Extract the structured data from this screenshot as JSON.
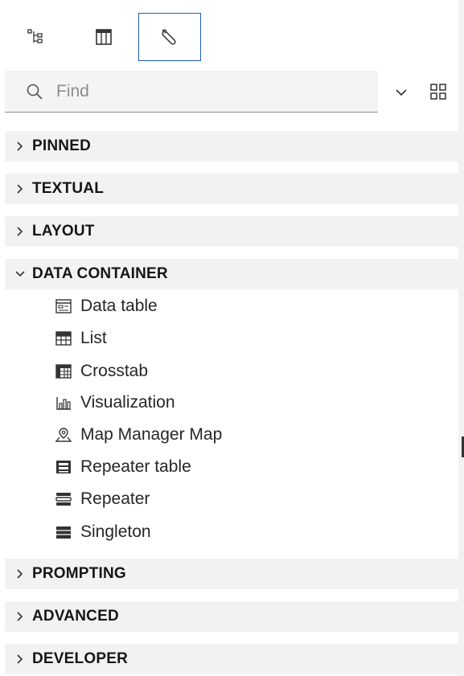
{
  "tabs": [
    {
      "icon": "hierarchy-icon",
      "selected": false
    },
    {
      "icon": "layout-icon",
      "selected": false
    },
    {
      "icon": "wrench-icon",
      "selected": true
    }
  ],
  "search": {
    "placeholder": "Find",
    "value": ""
  },
  "sections": {
    "pinned": "PINNED",
    "textual": "TEXTUAL",
    "layout": "LAYOUT",
    "data_container": "DATA CONTAINER",
    "prompting": "PROMPTING",
    "advanced": "ADVANCED",
    "developer": "DEVELOPER"
  },
  "data_container_items": [
    {
      "label": "Data table",
      "icon": "data-table-icon"
    },
    {
      "label": "List",
      "icon": "list-icon"
    },
    {
      "label": "Crosstab",
      "icon": "crosstab-icon"
    },
    {
      "label": "Visualization",
      "icon": "visualization-icon"
    },
    {
      "label": "Map Manager Map",
      "icon": "map-icon"
    },
    {
      "label": "Repeater table",
      "icon": "repeater-table-icon"
    },
    {
      "label": "Repeater",
      "icon": "repeater-icon"
    },
    {
      "label": "Singleton",
      "icon": "singleton-icon"
    }
  ],
  "colors": {
    "selected_border": "#1f5bbf",
    "section_bg": "#f2f2f2",
    "search_bg": "#f4f4f4"
  }
}
